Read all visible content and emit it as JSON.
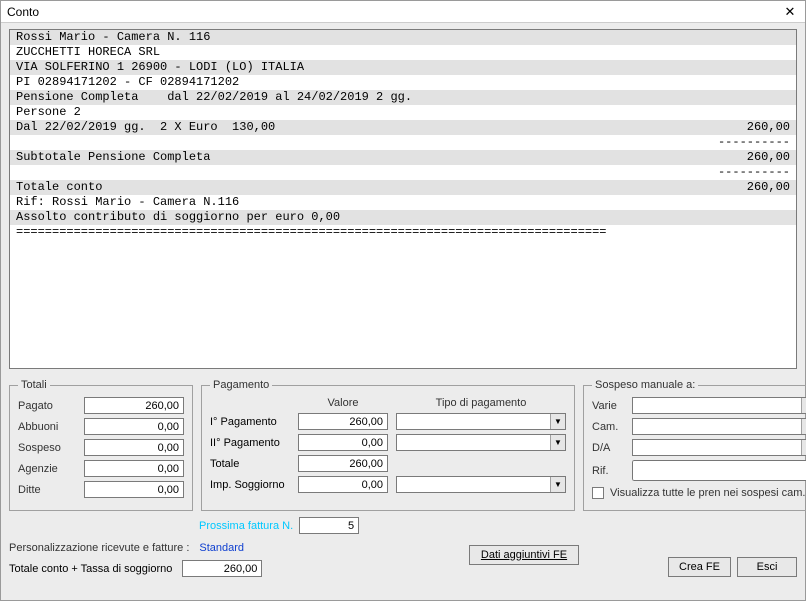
{
  "window": {
    "title": "Conto"
  },
  "receipt": {
    "lines": [
      {
        "left": "Rossi Mario - Camera N. 116",
        "right": "",
        "alt": true
      },
      {
        "left": "ZUCCHETTI HORECA SRL",
        "right": "",
        "alt": false
      },
      {
        "left": "VIA SOLFERINO 1 26900 - LODI (LO) ITALIA",
        "right": "",
        "alt": true
      },
      {
        "left": "PI 02894171202 - CF 02894171202",
        "right": "",
        "alt": false
      },
      {
        "left": "Pensione Completa    dal 22/02/2019 al 24/02/2019 2 gg.",
        "right": "",
        "alt": true
      },
      {
        "left": "Persone 2",
        "right": "",
        "alt": false
      },
      {
        "left": "Dal 22/02/2019 gg.  2 X Euro  130,00",
        "right": "260,00",
        "alt": true
      },
      {
        "left": "",
        "right": "----------",
        "alt": false
      },
      {
        "left": "Subtotale Pensione Completa",
        "right": "260,00",
        "alt": true
      },
      {
        "left": "",
        "right": "----------",
        "alt": false
      },
      {
        "left": "Totale conto",
        "right": "260,00",
        "alt": true
      },
      {
        "left": "Rif: Rossi Mario - Camera N.116",
        "right": "",
        "alt": false
      },
      {
        "left": "Assolto contributo di soggiorno per euro 0,00",
        "right": "",
        "alt": true
      },
      {
        "left": "==================================================================================",
        "right": "",
        "alt": false
      }
    ]
  },
  "totali": {
    "legend": "Totali",
    "pagato_label": "Pagato",
    "pagato": "260,00",
    "abbuoni_label": "Abbuoni",
    "abbuoni": "0,00",
    "sospeso_label": "Sospeso",
    "sospeso": "0,00",
    "agenzie_label": "Agenzie",
    "agenzie": "0,00",
    "ditte_label": "Ditte",
    "ditte": "0,00"
  },
  "pagamento": {
    "legend": "Pagamento",
    "hdr_valore": "Valore",
    "hdr_tipo": "Tipo di pagamento",
    "p1_label": "I° Pagamento",
    "p1_val": "260,00",
    "p1_tipo": "",
    "p2_label": "II° Pagamento",
    "p2_val": "0,00",
    "p2_tipo": "",
    "tot_label": "Totale",
    "tot_val": "260,00",
    "imp_label": "Imp. Soggiorno",
    "imp_val": "0,00",
    "imp_tipo": ""
  },
  "sospeso": {
    "legend": "Sospeso manuale a:",
    "varie_label": "Varie",
    "varie": "",
    "cam_label": "Cam.",
    "cam": "",
    "da_label": "D/A",
    "da": "",
    "rif_label": "Rif.",
    "rif": "",
    "chk_label": "Visualizza tutte le pren nei sospesi cam."
  },
  "footer": {
    "prossima_label": "Prossima fattura N.",
    "prossima_val": "5",
    "pers_label": "Personalizzazione ricevute e fatture :",
    "pers_val": "Standard",
    "dati_btn": "Dati aggiuntivi FE",
    "tot_label": "Totale conto + Tassa di soggiorno",
    "tot_val": "260,00",
    "crea_btn": "Crea FE",
    "esci_btn": "Esci"
  }
}
